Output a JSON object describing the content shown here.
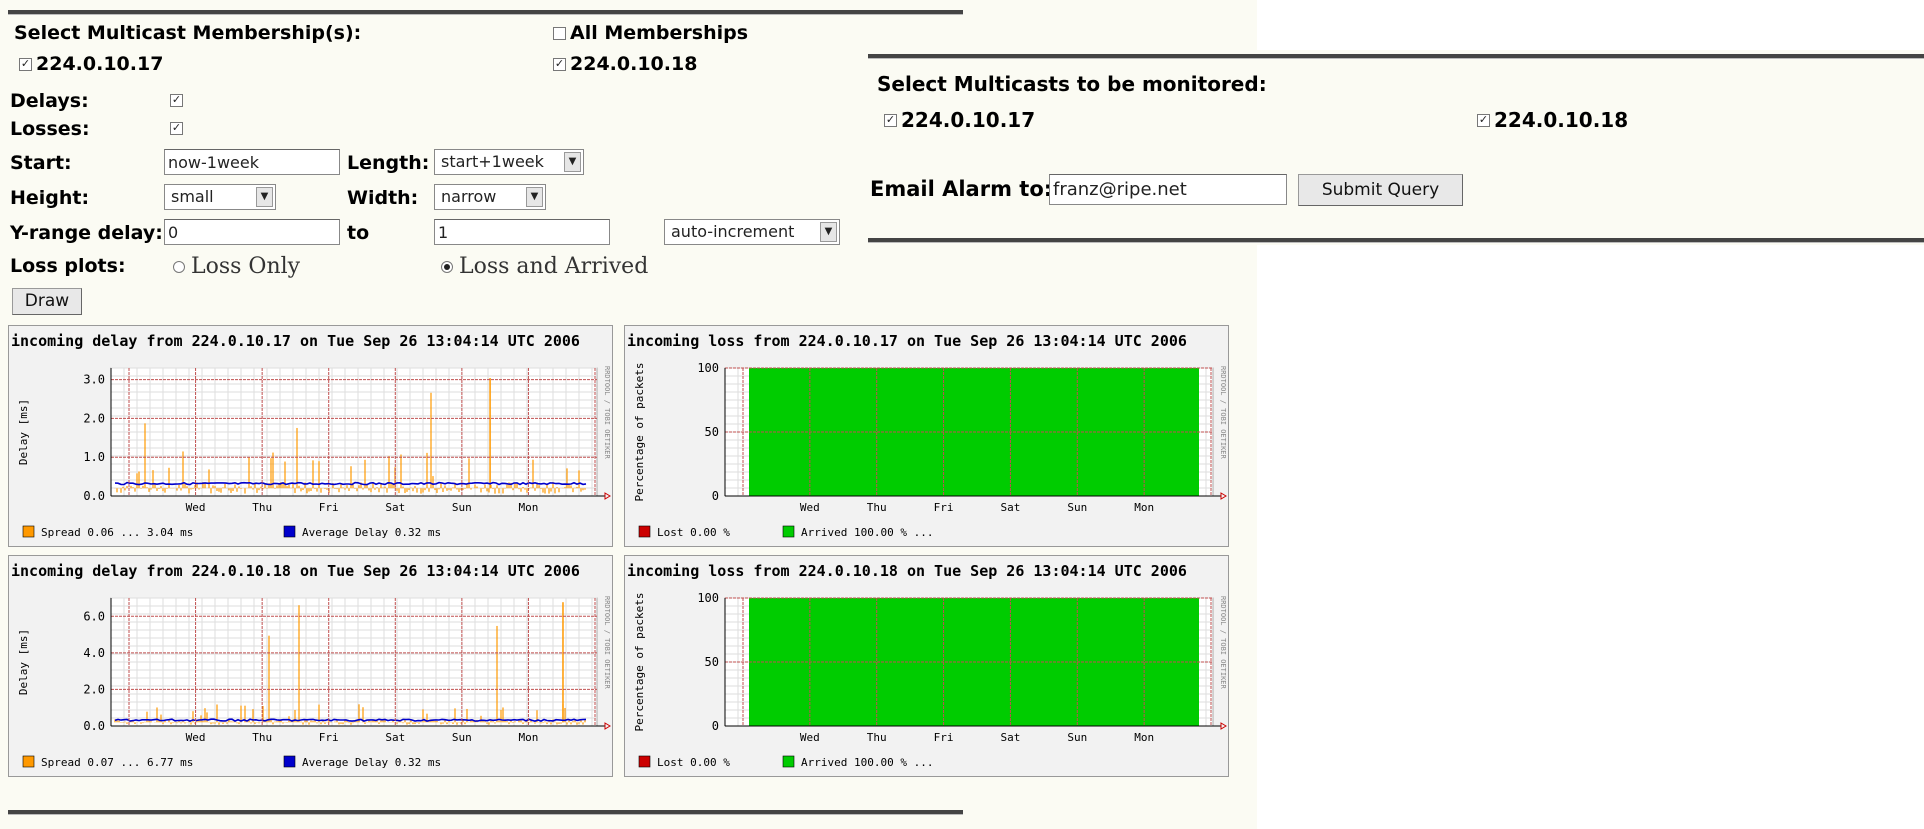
{
  "memberships": {
    "label": "Select Multicast Membership(s):",
    "all_label": "All Memberships",
    "all_checked": false,
    "items": [
      {
        "label": "224.0.10.17",
        "checked": true
      },
      {
        "label": "224.0.10.18",
        "checked": true
      }
    ]
  },
  "form": {
    "delays_label": "Delays:",
    "delays_checked": true,
    "losses_label": "Losses:",
    "losses_checked": true,
    "start_label": "Start:",
    "start_value": "now-1week",
    "length_label": "Length:",
    "length_value": "start+1week",
    "height_label": "Height:",
    "height_value": "small",
    "width_label": "Width:",
    "width_value": "narrow",
    "yrange_label": "Y-range delay:",
    "yrange_from": "0",
    "to_label": "to",
    "yrange_to": "1",
    "increment_value": "auto-increment",
    "loss_plots_label": "Loss plots:",
    "loss_only_label": "Loss Only",
    "loss_arrived_label": "Loss and Arrived",
    "loss_plot_selected": "Loss and Arrived",
    "draw_label": "Draw"
  },
  "monitor": {
    "label": "Select Multicasts to be monitored:",
    "items": [
      {
        "label": "224.0.10.17",
        "checked": true
      },
      {
        "label": "224.0.10.18",
        "checked": true
      }
    ],
    "email_label": "Email Alarm to:",
    "email_value": "franz@ripe.net",
    "submit_label": "Submit Query"
  },
  "charts": {
    "delay1": {
      "title": "incoming delay from 224.0.10.17 on Tue Sep 26 13:04:14 UTC 2006",
      "side": "RRDTOOL / TOBI OETIKER",
      "legend1": "Spread  0.06 ...   3.04 ms",
      "legend2": "Average Delay  0.32 ms"
    },
    "loss1": {
      "title": "incoming loss from 224.0.10.17 on Tue Sep 26 13:04:14 UTC 2006",
      "side": "RRDTOOL / TOBI OETIKER",
      "legend1": "Lost  0.00 %",
      "legend2": "Arrived  100.00 % ..."
    },
    "delay2": {
      "title": "incoming delay from 224.0.10.18 on Tue Sep 26 13:04:14 UTC 2006",
      "side": "RRDTOOL / TOBI OETIKER",
      "legend1": "Spread  0.07 ...   6.77 ms",
      "legend2": "Average Delay  0.32 ms"
    },
    "loss2": {
      "title": "incoming loss from 224.0.10.18 on Tue Sep 26 13:04:14 UTC 2006",
      "side": "RRDTOOL / TOBI OETIKER",
      "legend1": "Lost  0.00 %",
      "legend2": "Arrived  100.00 % ..."
    }
  },
  "colors": {
    "spread": "#ff9900",
    "average": "#0000cc",
    "lost": "#cc0000",
    "arrived": "#00cc00",
    "grid": "#c05050"
  },
  "chart_data": [
    {
      "type": "line",
      "title": "incoming delay from 224.0.10.17 on Tue Sep 26 13:04:14 UTC 2006",
      "ylabel": "Delay [ms]",
      "xlabel": "",
      "ylim": [
        0,
        3.3
      ],
      "yticks": [
        0.0,
        1.0,
        2.0,
        3.0
      ],
      "ytick_labels": [
        "0.0",
        "1.0",
        "2.0",
        "3.0"
      ],
      "x_tick_labels": [
        "Wed",
        "Thu",
        "Fri",
        "Sat",
        "Sun",
        "Mon"
      ],
      "series": [
        {
          "name": "Spread",
          "min": 0.06,
          "max": 3.04,
          "unit": "ms"
        },
        {
          "name": "Average Delay",
          "value": 0.32,
          "unit": "ms"
        }
      ]
    },
    {
      "type": "area",
      "title": "incoming loss from 224.0.10.17 on Tue Sep 26 13:04:14 UTC 2006",
      "ylabel": "Percentage of packets",
      "xlabel": "",
      "ylim": [
        0,
        100
      ],
      "yticks": [
        0,
        50,
        100
      ],
      "ytick_labels": [
        "0",
        "50",
        "100"
      ],
      "x_tick_labels": [
        "Wed",
        "Thu",
        "Fri",
        "Sat",
        "Sun",
        "Mon"
      ],
      "series": [
        {
          "name": "Lost",
          "value": 0.0,
          "unit": "%"
        },
        {
          "name": "Arrived",
          "value": 100.0,
          "unit": "%"
        }
      ]
    },
    {
      "type": "line",
      "title": "incoming delay from 224.0.10.18 on Tue Sep 26 13:04:14 UTC 2006",
      "ylabel": "Delay [ms]",
      "xlabel": "",
      "ylim": [
        0,
        7.0
      ],
      "yticks": [
        0.0,
        2.0,
        4.0,
        6.0
      ],
      "ytick_labels": [
        "0.0",
        "2.0",
        "4.0",
        "6.0"
      ],
      "x_tick_labels": [
        "Wed",
        "Thu",
        "Fri",
        "Sat",
        "Sun",
        "Mon"
      ],
      "series": [
        {
          "name": "Spread",
          "min": 0.07,
          "max": 6.77,
          "unit": "ms"
        },
        {
          "name": "Average Delay",
          "value": 0.32,
          "unit": "ms"
        }
      ]
    },
    {
      "type": "area",
      "title": "incoming loss from 224.0.10.18 on Tue Sep 26 13:04:14 UTC 2006",
      "ylabel": "Percentage of packets",
      "xlabel": "",
      "ylim": [
        0,
        100
      ],
      "yticks": [
        0,
        50,
        100
      ],
      "ytick_labels": [
        "0",
        "50",
        "100"
      ],
      "x_tick_labels": [
        "Wed",
        "Thu",
        "Fri",
        "Sat",
        "Sun",
        "Mon"
      ],
      "series": [
        {
          "name": "Lost",
          "value": 0.0,
          "unit": "%"
        },
        {
          "name": "Arrived",
          "value": 100.0,
          "unit": "%"
        }
      ]
    }
  ]
}
